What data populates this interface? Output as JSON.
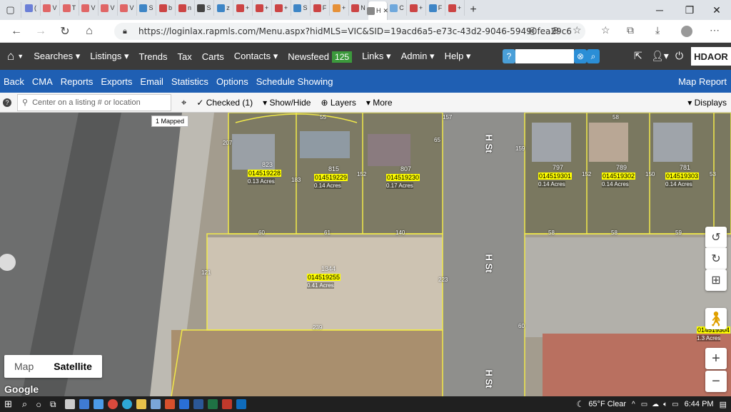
{
  "browser": {
    "url": "https://loginlax.rapmls.com/Menu.aspx?hidMLS=VIC&SID=19acd6a5-e73c-43d2-9046-59490fea29c6",
    "tabs": [
      {
        "label": "(",
        "color": "#6b7fd7"
      },
      {
        "label": "V",
        "color": "#e06666"
      },
      {
        "label": "T",
        "color": "#e06666"
      },
      {
        "label": "V",
        "color": "#e06666"
      },
      {
        "label": "V",
        "color": "#e06666"
      },
      {
        "label": "V",
        "color": "#e06666"
      },
      {
        "label": "S",
        "color": "#3d85c6"
      },
      {
        "label": "b",
        "color": "#cc4444"
      },
      {
        "label": "n",
        "color": "#cc4444"
      },
      {
        "label": "S",
        "color": "#444444"
      },
      {
        "label": "z",
        "color": "#3d85c6"
      },
      {
        "label": "+",
        "color": "#cc4444"
      },
      {
        "label": "+",
        "color": "#cc4444"
      },
      {
        "label": "+",
        "color": "#cc4444"
      },
      {
        "label": "S",
        "color": "#3d85c6"
      },
      {
        "label": "F",
        "color": "#cc4444"
      },
      {
        "label": "+",
        "color": "#e69138"
      },
      {
        "label": "N",
        "color": "#cc4444"
      },
      {
        "label": "H",
        "color": "#888888"
      },
      {
        "label": "C",
        "color": "#6fa8dc"
      },
      {
        "label": "+",
        "color": "#cc4444"
      },
      {
        "label": "F",
        "color": "#3d85c6"
      },
      {
        "label": "+",
        "color": "#cc4444"
      }
    ]
  },
  "nav": {
    "searches": "Searches",
    "listings": "Listings",
    "trends": "Trends",
    "tax": "Tax",
    "carts": "Carts",
    "contacts": "Contacts",
    "newsfeed": "Newsfeed",
    "newsfeed_count": "125",
    "links": "Links",
    "admin": "Admin",
    "help": "Help",
    "help_q": "?",
    "logo": "HDAOR"
  },
  "menu": {
    "items": [
      "Back",
      "CMA",
      "Reports",
      "Exports",
      "Email",
      "Statistics",
      "Options",
      "Schedule Showing"
    ],
    "map_report": "Map Report"
  },
  "toolbar": {
    "location_placeholder": "Center on a listing # or location",
    "checked": "Checked (1)",
    "show_hide": "Show/Hide",
    "layers": "Layers",
    "more": "More",
    "displays": "Displays",
    "mapped": "1 Mapped"
  },
  "map": {
    "street_label": "H St",
    "parcels": [
      {
        "num": "823",
        "apn": "014519228",
        "acres": "0.13 Acres"
      },
      {
        "num": "815",
        "apn": "014519229",
        "acres": "0.14 Acres"
      },
      {
        "num": "807",
        "apn": "014519230",
        "acres": "0.17 Acres"
      },
      {
        "num": "797",
        "apn": "014519301",
        "acres": "0.14 Acres"
      },
      {
        "num": "789",
        "apn": "014519302",
        "acres": "0.14 Acres"
      },
      {
        "num": "781",
        "apn": "014519303",
        "acres": "0.14 Acres"
      },
      {
        "num": "1344",
        "apn": "014519255",
        "acres": "0.41 Acres"
      },
      {
        "num": "",
        "apn": "014519304",
        "acres": "1.3 Acres"
      }
    ],
    "edge_labels": [
      "207",
      "55",
      "65",
      "183",
      "152",
      "157",
      "159",
      "152",
      "150",
      "53",
      "58",
      "58",
      "58",
      "59",
      "60",
      "61",
      "140",
      "121",
      "223",
      "239",
      "60"
    ],
    "map_btn": "Map",
    "satellite_btn": "Satellite",
    "google": "Google"
  },
  "taskbar": {
    "weather": "65°F Clear",
    "time": "6:44 PM"
  }
}
